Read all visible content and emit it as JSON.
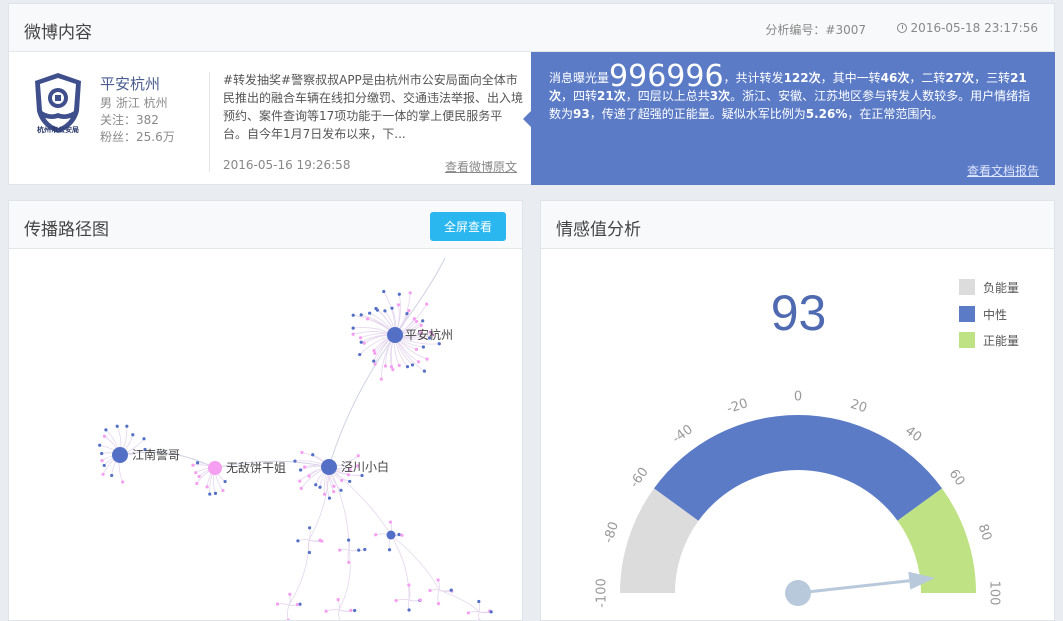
{
  "weibo": {
    "panel_title": "微博内容",
    "analysis_id": "分析编号：#3007",
    "timestamp": "2016-05-18 23:17:56",
    "account": {
      "name": "平安杭州",
      "location": "男 浙江 杭州",
      "following": "关注：382",
      "followers": "粉丝：25.6万",
      "logo_text": "杭州市公安局"
    },
    "post": {
      "text": "#转发抽奖#警察叔叔APP是由杭州市公安局面向全体市民推出的融合车辆在线扣分缴罚、交通违法举报、出入境预约、案件查询等17项功能于一体的掌上便民服务平台。自今年1月7日发布以来，下...",
      "date": "2016-05-16 19:26:58",
      "link": "查看微博原文"
    },
    "summary": {
      "prefix": "消息曝光量",
      "exposure": "996996",
      "s1": "，共计转发",
      "total": "122次",
      "s2": "，其中一转",
      "l1": "46次",
      "s3": "，二转",
      "l2": "27次",
      "s4": "，三转",
      "l3": "21次",
      "s5": "，四转",
      "l4": "21次",
      "s6": "，四层以上总共",
      "l5": "3次",
      "s7": "。浙江、安徽、江苏地区参与转发人数较多。用户情绪指数为",
      "mood": "93",
      "s8": "，传递了超强的正能量。疑似水军比例为",
      "bots": "5.26%",
      "s9": "，在正常范围内。",
      "link": "查看文档报告"
    }
  },
  "path": {
    "panel_title": "传播路径图",
    "fullscreen_label": "全屏查看",
    "nodes": [
      {
        "label": "平安杭州",
        "color": "#5470c6"
      },
      {
        "label": "江南警哥",
        "color": "#5470c6"
      },
      {
        "label": "无敌饼干姐",
        "color": "#f59ff0"
      },
      {
        "label": "泾川小白",
        "color": "#5470c6"
      }
    ]
  },
  "sentiment": {
    "panel_title": "情感值分析",
    "value": "93",
    "legend": [
      {
        "label": "负能量",
        "color": "#dcdcdc"
      },
      {
        "label": "中性",
        "color": "#5b7bc6"
      },
      {
        "label": "正能量",
        "color": "#bfe284"
      }
    ],
    "gauge": {
      "min": -100,
      "max": 100,
      "ticks": [
        "-100",
        "-80",
        "-60",
        "-40",
        "-20",
        "0",
        "20",
        "40",
        "60",
        "80",
        "100"
      ],
      "bands": [
        [
          -100,
          -60
        ],
        [
          -60,
          60
        ],
        [
          60,
          100
        ]
      ],
      "needle_value": 93
    }
  }
}
